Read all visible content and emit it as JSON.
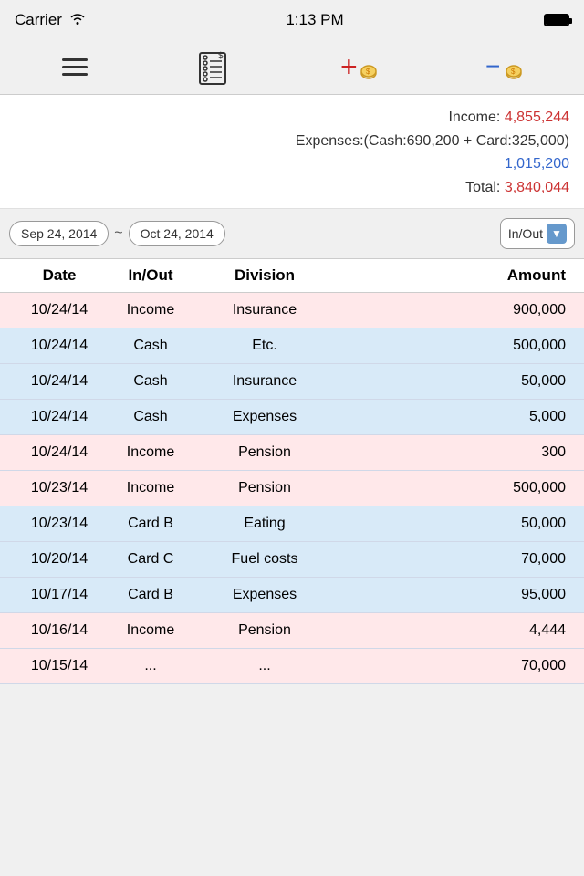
{
  "statusBar": {
    "carrier": "Carrier",
    "wifi": "wifi",
    "time": "1:13 PM"
  },
  "toolbar": {
    "menuLabel": "≡",
    "notebookLabel": "📋",
    "addLabel": "+",
    "subtractLabel": "−"
  },
  "summary": {
    "incomeLabel": "Income:",
    "incomeValue": "4,855,244",
    "expensesLabel": "Expenses:(Cash:690,200 + Card:325,000)",
    "expensesValue": "1,015,200",
    "totalLabel": "Total:",
    "totalValue": "3,840,044"
  },
  "filter": {
    "startDate": "Sep 24, 2014",
    "tilde": "~",
    "endDate": "Oct 24, 2014",
    "filterLabel": "In/Out"
  },
  "table": {
    "headers": [
      "Date",
      "In/Out",
      "Division",
      "Amount"
    ],
    "rows": [
      {
        "date": "10/24/14",
        "inout": "Income",
        "division": "Insurance",
        "amount": "900,000",
        "type": "income"
      },
      {
        "date": "10/24/14",
        "inout": "Cash",
        "division": "Etc.",
        "amount": "500,000",
        "type": "expense"
      },
      {
        "date": "10/24/14",
        "inout": "Cash",
        "division": "Insurance",
        "amount": "50,000",
        "type": "expense"
      },
      {
        "date": "10/24/14",
        "inout": "Cash",
        "division": "Expenses",
        "amount": "5,000",
        "type": "expense"
      },
      {
        "date": "10/24/14",
        "inout": "Income",
        "division": "Pension",
        "amount": "300",
        "type": "income"
      },
      {
        "date": "10/23/14",
        "inout": "Income",
        "division": "Pension",
        "amount": "500,000",
        "type": "income"
      },
      {
        "date": "10/23/14",
        "inout": "Card B",
        "division": "Eating",
        "amount": "50,000",
        "type": "expense"
      },
      {
        "date": "10/20/14",
        "inout": "Card C",
        "division": "Fuel costs",
        "amount": "70,000",
        "type": "expense"
      },
      {
        "date": "10/17/14",
        "inout": "Card B",
        "division": "Expenses",
        "amount": "95,000",
        "type": "expense"
      },
      {
        "date": "10/16/14",
        "inout": "Income",
        "division": "Pension",
        "amount": "4,444",
        "type": "income"
      },
      {
        "date": "10/15/14",
        "inout": "...",
        "division": "...",
        "amount": "70,000",
        "type": "income"
      }
    ]
  }
}
